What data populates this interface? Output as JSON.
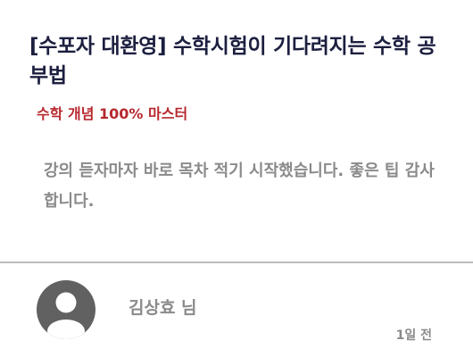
{
  "post": {
    "title": "[수포자 대환영] 수학시험이 기다려지는 수학 공부법",
    "subtitle": "수학 개념 100% 마스터"
  },
  "comment": {
    "text": "강의 듣자마자 바로 목차 적기 시작했습니다. 좋은 팁 감사합니다.",
    "author": "김상효 님",
    "time": "1일 전",
    "avatar_icon": "user-avatar-icon"
  },
  "colors": {
    "title": "#1c1f3f",
    "subtitle": "#b7282e",
    "muted": "#8a8a8a",
    "divider": "#bcbcbc",
    "avatar": "#616161"
  }
}
